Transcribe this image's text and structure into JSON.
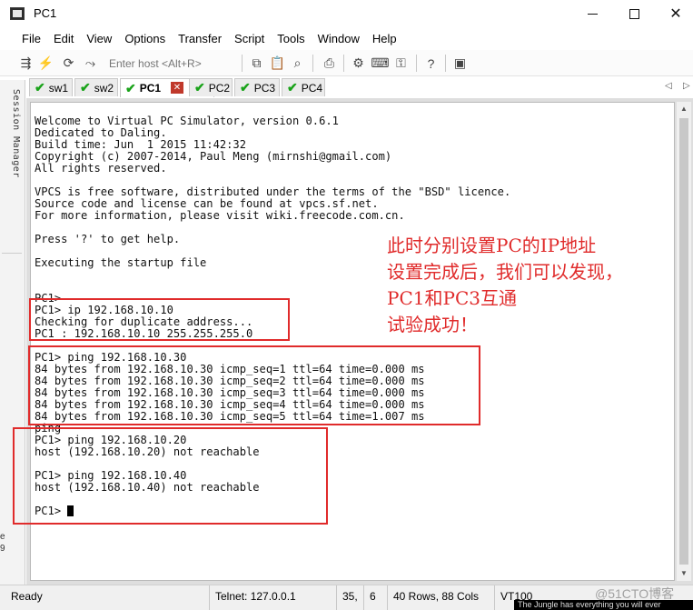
{
  "window": {
    "title": "PC1"
  },
  "menu": [
    "File",
    "Edit",
    "View",
    "Options",
    "Transfer",
    "Script",
    "Tools",
    "Window",
    "Help"
  ],
  "toolbar": {
    "host_placeholder": "Enter host <Alt+R>"
  },
  "tabs": [
    {
      "label": "sw1",
      "status": "connected"
    },
    {
      "label": "sw2",
      "status": "connected"
    },
    {
      "label": "PC1",
      "status": "connected",
      "active": true
    },
    {
      "label": "PC2",
      "status": "connected"
    },
    {
      "label": "PC3",
      "status": "connected"
    },
    {
      "label": "PC4",
      "status": "connected"
    }
  ],
  "session_panel": {
    "label": "Session Manager"
  },
  "terminal": {
    "lines": [
      "Welcome to Virtual PC Simulator, version 0.6.1",
      "Dedicated to Daling.",
      "Build time: Jun  1 2015 11:42:32",
      "Copyright (c) 2007-2014, Paul Meng (mirnshi@gmail.com)",
      "All rights reserved.",
      "",
      "VPCS is free software, distributed under the terms of the \"BSD\" licence.",
      "Source code and license can be found at vpcs.sf.net.",
      "For more information, please visit wiki.freecode.com.cn.",
      "",
      "Press '?' to get help.",
      "",
      "Executing the startup file",
      "",
      "",
      "PC1>",
      "PC1> ip 192.168.10.10",
      "Checking for duplicate address...",
      "PC1 : 192.168.10.10 255.255.255.0",
      "",
      "PC1> ping 192.168.10.30",
      "84 bytes from 192.168.10.30 icmp_seq=1 ttl=64 time=0.000 ms",
      "84 bytes from 192.168.10.30 icmp_seq=2 ttl=64 time=0.000 ms",
      "84 bytes from 192.168.10.30 icmp_seq=3 ttl=64 time=0.000 ms",
      "84 bytes from 192.168.10.30 icmp_seq=4 ttl=64 time=0.000 ms",
      "84 bytes from 192.168.10.30 icmp_seq=5 ttl=64 time=1.007 ms",
      "ping",
      "PC1> ping 192.168.10.20",
      "host (192.168.10.20) not reachable",
      "",
      "PC1> ping 192.168.10.40",
      "host (192.168.10.40) not reachable",
      "",
      "PC1> "
    ]
  },
  "annotation": {
    "lines": [
      "此时分别设置PC的IP地址",
      "设置完成后，我们可以发现，",
      "PC1和PC3互通",
      "试验成功！"
    ],
    "color": "#e02b2b"
  },
  "statusbar": {
    "ready": "Ready",
    "connection": "Telnet: 127.0.0.1",
    "row": "35,",
    "col": "6",
    "size": "40 Rows, 88 Cols",
    "emulation": "VT100"
  },
  "watermark": "@51CTO博客",
  "ad_strip": "The Jungle has everything you will ever",
  "side_fragments": [
    "e",
    "9"
  ]
}
